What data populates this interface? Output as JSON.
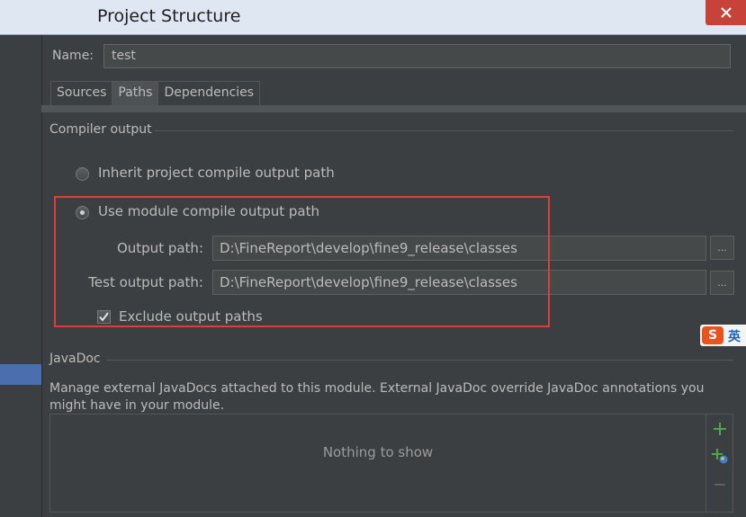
{
  "window": {
    "title": "Project Structure"
  },
  "module": {
    "name_label": "Name:",
    "name_value": "test"
  },
  "tabs": [
    {
      "label": "Sources",
      "selected": false
    },
    {
      "label": "Paths",
      "selected": true
    },
    {
      "label": "Dependencies",
      "selected": false
    }
  ],
  "compiler_output": {
    "section_title": "Compiler output",
    "inherit_option": {
      "label": "Inherit project compile output path",
      "selected": false
    },
    "module_option": {
      "label": "Use module compile output path",
      "selected": true
    },
    "output_path": {
      "label": "Output path:",
      "value": "D:\\FineReport\\develop\\fine9_release\\classes",
      "browse_label": "..."
    },
    "test_output_path": {
      "label": "Test output path:",
      "value": "D:\\FineReport\\develop\\fine9_release\\classes",
      "browse_label": "..."
    },
    "exclude": {
      "label": "Exclude output paths",
      "checked": true
    }
  },
  "javadoc": {
    "section_title": "JavaDoc",
    "description": "Manage external JavaDocs attached to this module. External JavaDoc override JavaDoc annotations you might have in your module.",
    "empty_text": "Nothing to show",
    "toolbar": [
      {
        "icon": "add-icon"
      },
      {
        "icon": "add-url-icon"
      },
      {
        "icon": "remove-icon"
      }
    ]
  },
  "ime": {
    "logo_text": "S",
    "language": "英"
  },
  "colors": {
    "background": "#3c3f41",
    "highlight_box": "#e23b3b",
    "add_green": "#4aa845",
    "selection_blue": "#4b6eaf"
  }
}
